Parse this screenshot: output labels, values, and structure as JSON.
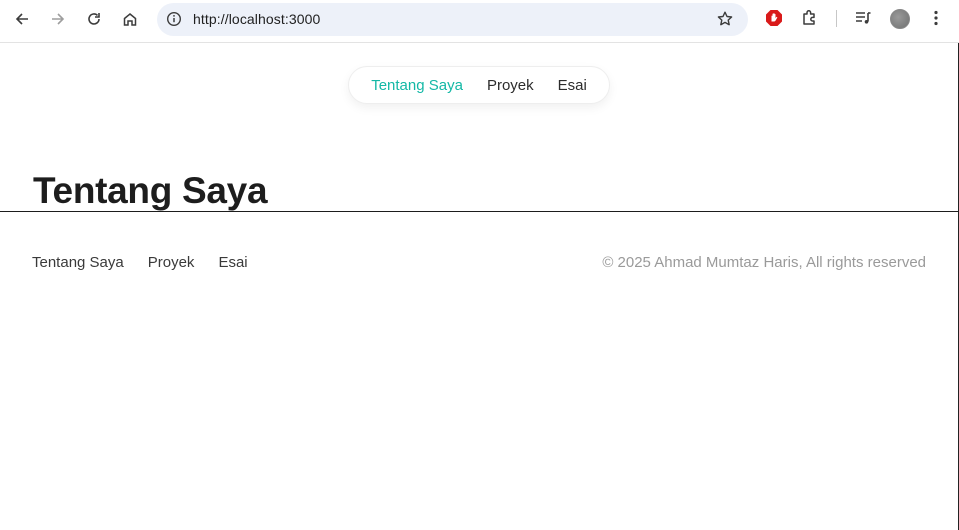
{
  "browser": {
    "url": "http://localhost:3000"
  },
  "header_nav": {
    "items": [
      "Tentang Saya",
      "Proyek",
      "Esai"
    ],
    "active_index": 0,
    "accent_color": "#14b8a6"
  },
  "main": {
    "title": "Tentang Saya"
  },
  "footer": {
    "nav": [
      "Tentang Saya",
      "Proyek",
      "Esai"
    ],
    "copyright": "© 2025 Ahmad Mumtaz Haris, All rights reserved"
  },
  "icons": [
    "back-icon",
    "forward-icon",
    "reload-icon",
    "home-icon",
    "info-icon",
    "star-icon",
    "adblock-extension-icon",
    "extensions-icon",
    "media-controls-icon",
    "profile-avatar",
    "more-icon"
  ]
}
